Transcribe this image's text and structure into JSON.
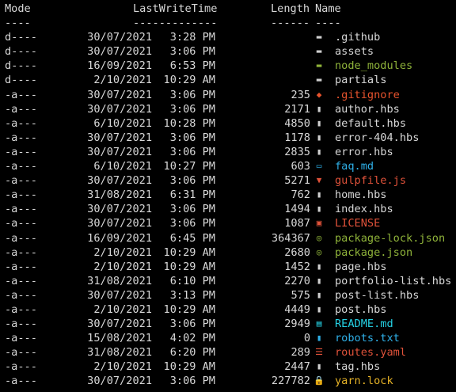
{
  "header": {
    "mode": "Mode",
    "lastwritetime": "LastWriteTime",
    "length": "Length",
    "name": "Name",
    "mode_rule": "----",
    "lwt_rule": "-------------",
    "length_rule": "------",
    "name_rule": "----"
  },
  "colors": {
    "default": "#d8d8d8",
    "green": "#8fb33a",
    "orange": "#e8532d",
    "blue": "#2fb0e8",
    "cyan": "#25d2e5",
    "red": "#e0523a",
    "yellow": "#e8b427"
  },
  "rows": [
    {
      "mode": "d----",
      "date": "30/07/2021",
      "time": "3:28 PM",
      "length": "",
      "icon": "folder-icon",
      "glyph": "▬",
      "name": ".github",
      "color": "default"
    },
    {
      "mode": "d----",
      "date": "30/07/2021",
      "time": "3:06 PM",
      "length": "",
      "icon": "folder-icon",
      "glyph": "▬",
      "name": "assets",
      "color": "default"
    },
    {
      "mode": "d----",
      "date": "16/09/2021",
      "time": "6:53 PM",
      "length": "",
      "icon": "folder-icon",
      "glyph": "▬",
      "name": "node_modules",
      "color": "green"
    },
    {
      "mode": "d----",
      "date": "2/10/2021",
      "time": "10:29 AM",
      "length": "",
      "icon": "folder-icon",
      "glyph": "▬",
      "name": "partials",
      "color": "default"
    },
    {
      "mode": "-a---",
      "date": "30/07/2021",
      "time": "3:06 PM",
      "length": "235",
      "icon": "git-icon",
      "glyph": "◆",
      "name": ".gitignore",
      "color": "orange"
    },
    {
      "mode": "-a---",
      "date": "30/07/2021",
      "time": "3:06 PM",
      "length": "2171",
      "icon": "file-icon",
      "glyph": "▮",
      "name": "author.hbs",
      "color": "default"
    },
    {
      "mode": "-a---",
      "date": "6/10/2021",
      "time": "10:28 PM",
      "length": "4850",
      "icon": "file-icon",
      "glyph": "▮",
      "name": "default.hbs",
      "color": "default"
    },
    {
      "mode": "-a---",
      "date": "30/07/2021",
      "time": "3:06 PM",
      "length": "1178",
      "icon": "file-icon",
      "glyph": "▮",
      "name": "error-404.hbs",
      "color": "default"
    },
    {
      "mode": "-a---",
      "date": "30/07/2021",
      "time": "3:06 PM",
      "length": "2835",
      "icon": "file-icon",
      "glyph": "▮",
      "name": "error.hbs",
      "color": "default"
    },
    {
      "mode": "-a---",
      "date": "6/10/2021",
      "time": "10:27 PM",
      "length": "603",
      "icon": "markdown-icon",
      "glyph": "▭",
      "name": "faq.md",
      "color": "blue"
    },
    {
      "mode": "-a---",
      "date": "30/07/2021",
      "time": "3:06 PM",
      "length": "5271",
      "icon": "gulp-icon",
      "glyph": "▼",
      "name": "gulpfile.js",
      "color": "red"
    },
    {
      "mode": "-a---",
      "date": "31/08/2021",
      "time": "6:31 PM",
      "length": "762",
      "icon": "file-icon",
      "glyph": "▮",
      "name": "home.hbs",
      "color": "default"
    },
    {
      "mode": "-a---",
      "date": "30/07/2021",
      "time": "3:06 PM",
      "length": "1494",
      "icon": "file-icon",
      "glyph": "▮",
      "name": "index.hbs",
      "color": "default"
    },
    {
      "mode": "-a---",
      "date": "30/07/2021",
      "time": "3:06 PM",
      "length": "1087",
      "icon": "license-icon",
      "glyph": "▣",
      "name": "LICENSE",
      "color": "red"
    },
    {
      "mode": "-a---",
      "date": "16/09/2021",
      "time": "6:45 PM",
      "length": "364367",
      "icon": "npm-icon",
      "glyph": "◎",
      "name": "package-lock.json",
      "color": "green"
    },
    {
      "mode": "-a---",
      "date": "2/10/2021",
      "time": "10:29 AM",
      "length": "2680",
      "icon": "npm-icon",
      "glyph": "◎",
      "name": "package.json",
      "color": "green"
    },
    {
      "mode": "-a---",
      "date": "2/10/2021",
      "time": "10:29 AM",
      "length": "1452",
      "icon": "file-icon",
      "glyph": "▮",
      "name": "page.hbs",
      "color": "default"
    },
    {
      "mode": "-a---",
      "date": "31/08/2021",
      "time": "6:10 PM",
      "length": "2270",
      "icon": "file-icon",
      "glyph": "▮",
      "name": "portfolio-list.hbs",
      "color": "default"
    },
    {
      "mode": "-a---",
      "date": "30/07/2021",
      "time": "3:13 PM",
      "length": "575",
      "icon": "file-icon",
      "glyph": "▮",
      "name": "post-list.hbs",
      "color": "default"
    },
    {
      "mode": "-a---",
      "date": "2/10/2021",
      "time": "10:29 AM",
      "length": "4449",
      "icon": "file-icon",
      "glyph": "▮",
      "name": "post.hbs",
      "color": "default"
    },
    {
      "mode": "-a---",
      "date": "30/07/2021",
      "time": "3:06 PM",
      "length": "2949",
      "icon": "readme-icon",
      "glyph": "▤",
      "name": "README.md",
      "color": "cyan"
    },
    {
      "mode": "-a---",
      "date": "15/08/2021",
      "time": "4:02 PM",
      "length": "0",
      "icon": "text-file-icon",
      "glyph": "▮",
      "name": "robots.txt",
      "color": "blue"
    },
    {
      "mode": "-a---",
      "date": "31/08/2021",
      "time": "6:20 PM",
      "length": "289",
      "icon": "yaml-icon",
      "glyph": "☰",
      "name": "routes.yaml",
      "color": "red"
    },
    {
      "mode": "-a---",
      "date": "2/10/2021",
      "time": "10:29 AM",
      "length": "2447",
      "icon": "file-icon",
      "glyph": "▮",
      "name": "tag.hbs",
      "color": "default"
    },
    {
      "mode": "-a---",
      "date": "30/07/2021",
      "time": "3:06 PM",
      "length": "227782",
      "icon": "lock-icon",
      "glyph": "🔒",
      "name": "yarn.lock",
      "color": "yellow"
    }
  ]
}
